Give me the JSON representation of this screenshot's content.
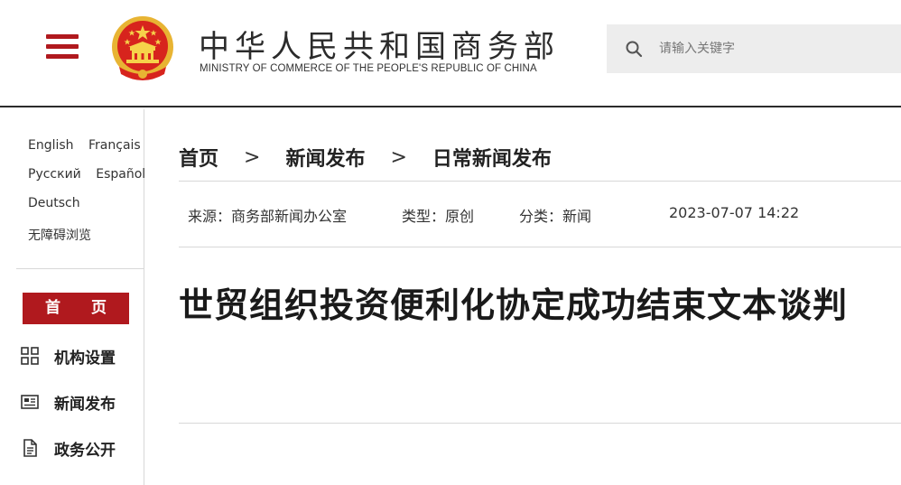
{
  "header": {
    "title": "中华人民共和国商务部",
    "subtitle": "MINISTRY OF COMMERCE OF THE PEOPLE'S REPUBLIC OF CHINA",
    "emblem_icon": "national-emblem-icon",
    "menu_icon": "hamburger-menu-icon",
    "brand_color": "#b0191e"
  },
  "search": {
    "placeholder": "请输入关键字",
    "icon": "search-icon"
  },
  "sidebar": {
    "languages_row1": [
      "English",
      "Français"
    ],
    "languages_row2": [
      "Русский",
      "Español"
    ],
    "languages_row3": [
      "Deutsch"
    ],
    "accessibility": "无障碍浏览",
    "home_label": "首 页",
    "nav": [
      {
        "label": "机构设置",
        "icon": "grid-icon"
      },
      {
        "label": "新闻发布",
        "icon": "news-icon"
      },
      {
        "label": "政务公开",
        "icon": "document-icon"
      }
    ]
  },
  "breadcrumb": {
    "items": [
      "首页",
      "新闻发布",
      "日常新闻发布"
    ],
    "separator": ">"
  },
  "meta": {
    "source": "来源：商务部新闻办公室",
    "type": "类型：原创",
    "category": "分类：新闻",
    "datetime": "2023-07-07 14:22"
  },
  "article": {
    "title": "世贸组织投资便利化协定成功结束文本谈判"
  }
}
